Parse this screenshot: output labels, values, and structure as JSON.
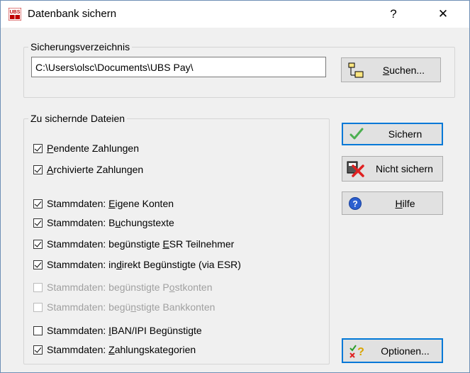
{
  "window": {
    "title": "Datenbank sichern",
    "help_glyph": "?",
    "close_glyph": "✕"
  },
  "backup_dir": {
    "legend": "Sicherungsverzeichnis",
    "path_value": "C:\\Users\\olsc\\Documents\\UBS Pay\\",
    "browse_label": "Suchen...",
    "browse_mnemonic": "S",
    "browse_rest": "uchen..."
  },
  "files": {
    "legend": "Zu sichernde Dateien",
    "items": [
      {
        "pre": "",
        "mn": "P",
        "post": "endente Zahlungen",
        "checked": true,
        "enabled": true
      },
      {
        "pre": "",
        "mn": "A",
        "post": "rchivierte Zahlungen",
        "checked": true,
        "enabled": true
      },
      {
        "pre": "Stammdaten: ",
        "mn": "E",
        "post": "igene Konten",
        "checked": true,
        "enabled": true
      },
      {
        "pre": "Stammdaten: B",
        "mn": "u",
        "post": "chungstexte",
        "checked": true,
        "enabled": true
      },
      {
        "pre": "Stammdaten: begünstigte ",
        "mn": "E",
        "post": "SR Teilnehmer",
        "checked": true,
        "enabled": true
      },
      {
        "pre": "Stammdaten: in",
        "mn": "d",
        "post": "irekt Begünstigte (via ESR)",
        "checked": true,
        "enabled": true
      },
      {
        "pre": "Stammdaten: begünstigte P",
        "mn": "o",
        "post": "stkonten",
        "checked": false,
        "enabled": false
      },
      {
        "pre": "Stammdaten: begü",
        "mn": "n",
        "post": "stigte Bankkonten",
        "checked": false,
        "enabled": false
      },
      {
        "pre": "Stammdaten: ",
        "mn": "I",
        "post": "BAN/IPI Begünstigte",
        "checked": false,
        "enabled": true
      },
      {
        "pre": "Stammdaten: ",
        "mn": "Z",
        "post": "ahlungskategorien",
        "checked": true,
        "enabled": true
      }
    ]
  },
  "buttons": {
    "save": {
      "label": "Sichern"
    },
    "dont_save": {
      "label": "Nicht sichern"
    },
    "help": {
      "pre": "",
      "mn": "H",
      "post": "ilfe"
    },
    "options": {
      "label": "Optionen..."
    }
  },
  "colors": {
    "accent": "#0078d7",
    "disabled_text": "#a0a0a0",
    "check_green": "#4caf50",
    "cross_red": "#e02020"
  }
}
